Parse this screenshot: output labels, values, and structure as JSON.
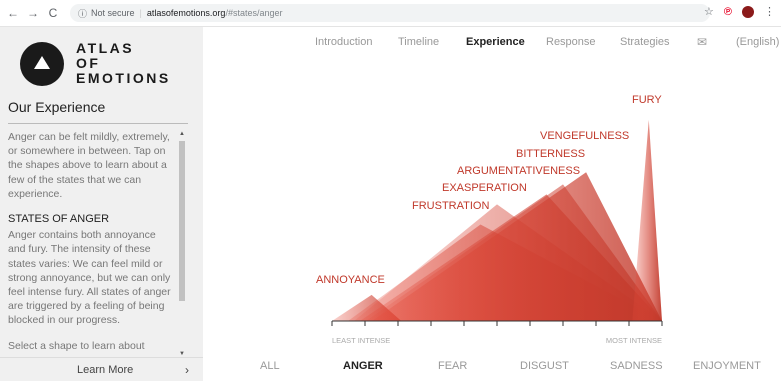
{
  "browser": {
    "back": "←",
    "forward": "→",
    "reload": "C",
    "security": "Not secure",
    "host": "atlasofemotions.org",
    "path": "/#states/anger"
  },
  "sidebar": {
    "logo_line1": "ATLAS",
    "logo_line2": "OF",
    "logo_line3": "EMOTIONS",
    "title": "Our Experience",
    "intro": "Anger can be felt mildly, extremely, or somewhere in between. Tap on the shapes above to learn about a few of the states that we can experience.",
    "states_heading": "STATES OF ANGER",
    "states_text": "Anger contains both annoyance and fury. The intensity of these states varies: We can feel mild or strong annoyance, but we can only feel intense fury. All states of anger are triggered by a feeling of being blocked in our progress.",
    "select_text": "Select a shape to learn about",
    "learn_more": "Learn More"
  },
  "nav": {
    "items": [
      "Introduction",
      "Timeline",
      "Experience",
      "Response",
      "Strategies"
    ],
    "active": "Experience",
    "language": "(English)"
  },
  "chart_data": {
    "type": "area",
    "title": "",
    "xlabel_left": "LEAST INTENSE",
    "xlabel_right": "MOST INTENSE",
    "states": [
      {
        "name": "ANNOYANCE",
        "peak_intensity": 1.2,
        "peak_height": 0.13
      },
      {
        "name": "FRUSTRATION",
        "peak_intensity": 4.5,
        "peak_height": 0.48
      },
      {
        "name": "EXASPERATION",
        "peak_intensity": 5.0,
        "peak_height": 0.58
      },
      {
        "name": "ARGUMENTATIVENESS",
        "peak_intensity": 6.5,
        "peak_height": 0.63
      },
      {
        "name": "BITTERNESS",
        "peak_intensity": 7.0,
        "peak_height": 0.68
      },
      {
        "name": "VENGEFULNESS",
        "peak_intensity": 7.7,
        "peak_height": 0.74
      },
      {
        "name": "FURY",
        "peak_intensity": 9.6,
        "peak_height": 1.0
      }
    ]
  },
  "emotion_tabs": {
    "items": [
      "ALL",
      "ANGER",
      "FEAR",
      "DISGUST",
      "SADNESS",
      "ENJOYMENT"
    ],
    "active": "ANGER"
  }
}
